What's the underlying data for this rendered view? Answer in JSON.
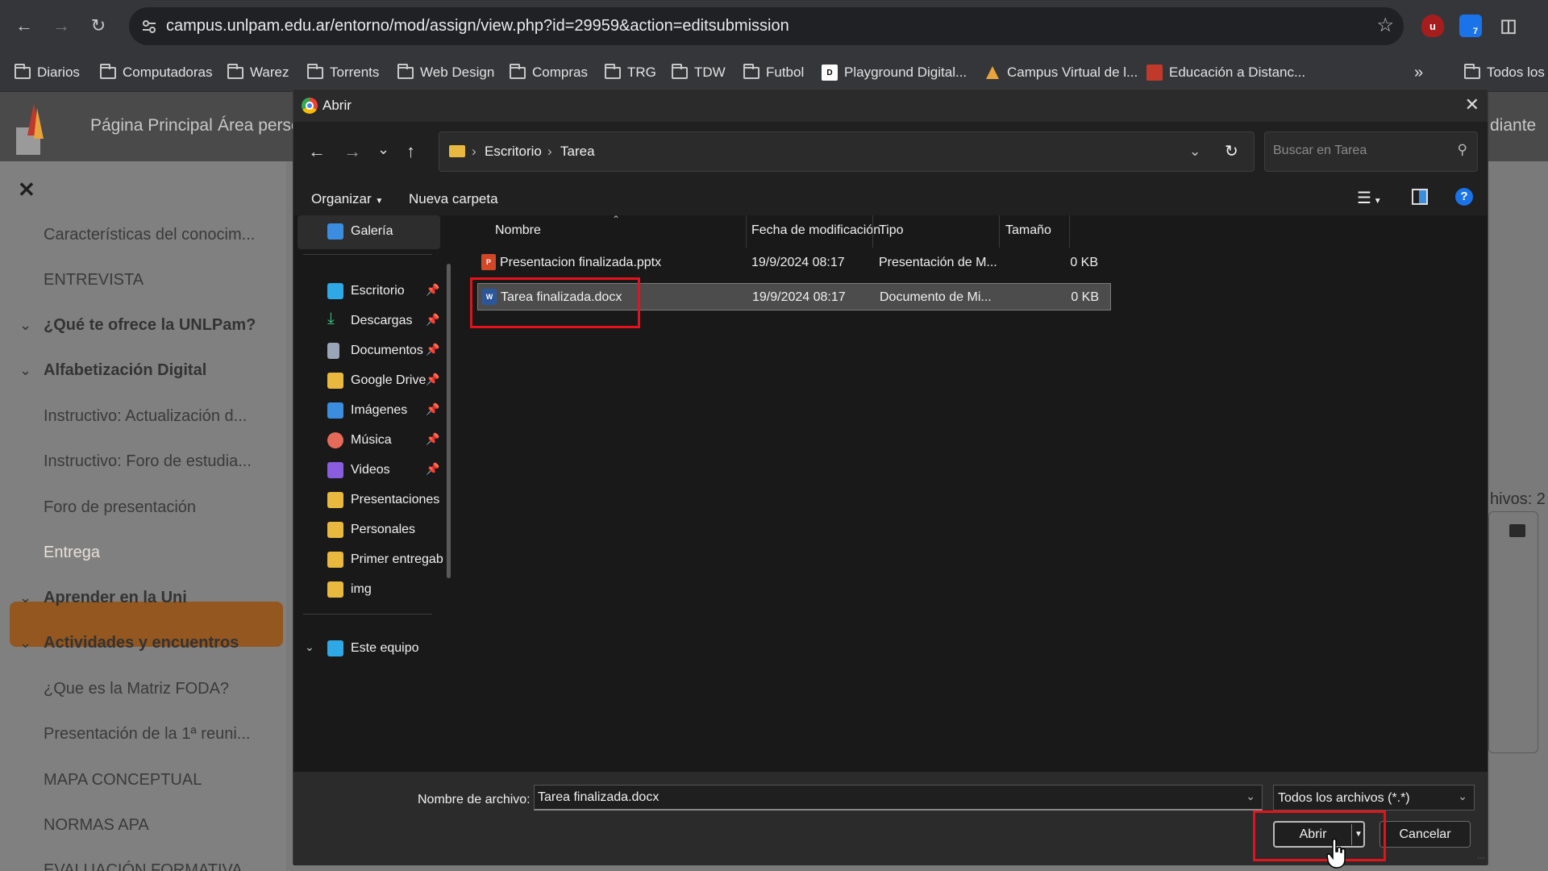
{
  "browser": {
    "url": "campus.unlpam.edu.ar/entorno/mod/assign/view.php?id=29959&action=editsubmission",
    "ext_ublock": "u",
    "ext_badge": "7"
  },
  "bookmarks": [
    {
      "label": "Diarios",
      "icon": "folder-icon"
    },
    {
      "label": "Computadoras",
      "icon": "folder-icon"
    },
    {
      "label": "Warez",
      "icon": "folder-icon"
    },
    {
      "label": "Torrents",
      "icon": "folder-icon"
    },
    {
      "label": "Web Design",
      "icon": "folder-icon"
    },
    {
      "label": "Compras",
      "icon": "folder-icon"
    },
    {
      "label": "TRG",
      "icon": "folder-icon"
    },
    {
      "label": "TDW",
      "icon": "folder-icon"
    },
    {
      "label": "Futbol",
      "icon": "folder-icon"
    },
    {
      "label": "Playground Digital...",
      "icon": "site-icon"
    },
    {
      "label": "Campus Virtual de l...",
      "icon": "site-icon"
    },
    {
      "label": "Educación a Distanc...",
      "icon": "site-icon"
    },
    {
      "label": "Todos los",
      "icon": "folder-icon"
    }
  ],
  "site": {
    "nav": [
      "Página Principal",
      "Área perso"
    ],
    "right_nav": "diante",
    "right_count": "hivos: 2"
  },
  "drawer": {
    "items": [
      {
        "label": "Características del conocim...",
        "type": "item"
      },
      {
        "label": "ENTREVISTA",
        "type": "item"
      },
      {
        "label": "¿Qué te ofrece la UNLPam?",
        "type": "section"
      },
      {
        "label": "Alfabetización Digital",
        "type": "section"
      },
      {
        "label": "Instructivo: Actualización d...",
        "type": "item"
      },
      {
        "label": "Instructivo: Foro de estudia...",
        "type": "item"
      },
      {
        "label": "Foro de presentación",
        "type": "item"
      },
      {
        "label": "Entrega",
        "type": "active"
      },
      {
        "label": "Aprender en la Uni",
        "type": "section"
      },
      {
        "label": "Actividades y encuentros",
        "type": "section"
      },
      {
        "label": "¿Que es la Matriz FODA?",
        "type": "item"
      },
      {
        "label": "Presentación de la 1ª reuni...",
        "type": "item"
      },
      {
        "label": "MAPA CONCEPTUAL",
        "type": "item"
      },
      {
        "label": "NORMAS APA",
        "type": "item"
      },
      {
        "label": "EVALUACIÓN FORMATIVA",
        "type": "item"
      }
    ]
  },
  "dialog": {
    "title": "Abrir",
    "path": [
      "Escritorio",
      "Tarea"
    ],
    "search_placeholder": "Buscar en Tarea",
    "organize": "Organizar",
    "new_folder": "Nueva carpeta",
    "nav_pane": [
      {
        "label": "Galería",
        "icon": "gallery-icon",
        "color": "#3b8de0",
        "pinned": false
      },
      {
        "label": "Escritorio",
        "icon": "desktop-icon",
        "color": "#2fa8e6",
        "pinned": true
      },
      {
        "label": "Descargas",
        "icon": "download-icon",
        "color": "#3fbf7f",
        "pinned": true
      },
      {
        "label": "Documentos",
        "icon": "documents-icon",
        "color": "#9aa6b8",
        "pinned": true
      },
      {
        "label": "Google Drive",
        "icon": "google-drive-icon",
        "color": "#e8b93e",
        "pinned": true
      },
      {
        "label": "Imágenes",
        "icon": "pictures-icon",
        "color": "#3b8de0",
        "pinned": true
      },
      {
        "label": "Música",
        "icon": "music-icon",
        "color": "#e56a5a",
        "pinned": true
      },
      {
        "label": "Videos",
        "icon": "videos-icon",
        "color": "#8a5ce0",
        "pinned": true
      },
      {
        "label": "Presentaciones",
        "icon": "folder-sync-icon",
        "color": "#e8b93e",
        "pinned": false
      },
      {
        "label": "Personales",
        "icon": "folder-sync-icon",
        "color": "#e8b93e",
        "pinned": false
      },
      {
        "label": "Primer entregab",
        "icon": "folder-sync-icon",
        "color": "#e8b93e",
        "pinned": false
      },
      {
        "label": "img",
        "icon": "folder-sync-icon",
        "color": "#e8b93e",
        "pinned": false
      },
      {
        "label": "Este equipo",
        "icon": "computer-icon",
        "color": "#2fa8e6",
        "pinned": false
      }
    ],
    "columns": [
      "Nombre",
      "Fecha de modificación",
      "Tipo",
      "Tamaño"
    ],
    "files": [
      {
        "name": "Presentacion finalizada.pptx",
        "date": "19/9/2024 08:17",
        "type": "Presentación de M...",
        "size": "0 KB",
        "icon": "powerpoint-file-icon",
        "selected": false
      },
      {
        "name": "Tarea finalizada.docx",
        "date": "19/9/2024 08:17",
        "type": "Documento de Mi...",
        "size": "0 KB",
        "icon": "word-file-icon",
        "selected": true
      }
    ],
    "filename_label": "Nombre de archivo:",
    "filename_value": "Tarea finalizada.docx",
    "filetype": "Todos los archivos (*.*)",
    "open_label": "Abrir",
    "cancel_label": "Cancelar"
  },
  "colors": {
    "highlight_red": "#e2131a",
    "active_drawer": "#93571f"
  }
}
